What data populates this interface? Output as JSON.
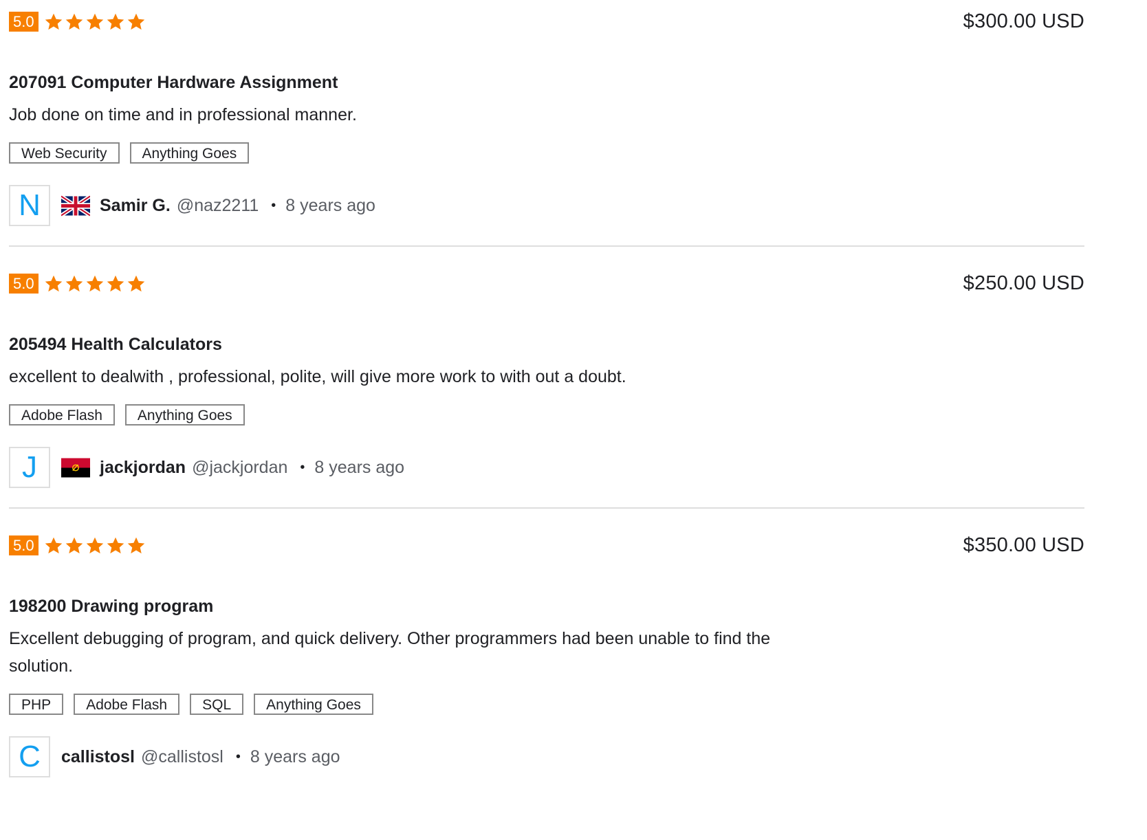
{
  "colors": {
    "accent": "#f77f00",
    "avatar_letter": "#139ff0",
    "text": "#1f2024",
    "muted": "#5a5d63",
    "divider": "#dedede"
  },
  "reviews": [
    {
      "rating": "5.0",
      "stars": 5,
      "price": "$300.00 USD",
      "title": "207091 Computer Hardware Assignment",
      "comment": "Job done on time and in professional manner.",
      "tags": [
        "Web Security",
        "Anything Goes"
      ],
      "avatar_letter": "N",
      "flag": "uk-flag-icon",
      "name": "Samir G.",
      "handle": "@naz2211",
      "separator": "•",
      "time": "8 years ago"
    },
    {
      "rating": "5.0",
      "stars": 5,
      "price": "$250.00 USD",
      "title": "205494 Health Calculators",
      "comment": "excellent to dealwith , professional, polite, will give more work to with out a doubt.",
      "tags": [
        "Adobe Flash",
        "Anything Goes"
      ],
      "avatar_letter": "J",
      "flag": "angola-flag-icon",
      "name": "jackjordan",
      "handle": "@jackjordan",
      "separator": "•",
      "time": "8 years ago"
    },
    {
      "rating": "5.0",
      "stars": 5,
      "price": "$350.00 USD",
      "title": "198200 Drawing program",
      "comment": "Excellent debugging of program, and quick delivery. Other programmers had been unable to find the solution.",
      "tags": [
        "PHP",
        "Adobe Flash",
        "SQL",
        "Anything Goes"
      ],
      "avatar_letter": "C",
      "flag": "",
      "name": "callistosl",
      "handle": "@callistosl",
      "separator": "•",
      "time": "8 years ago"
    }
  ]
}
